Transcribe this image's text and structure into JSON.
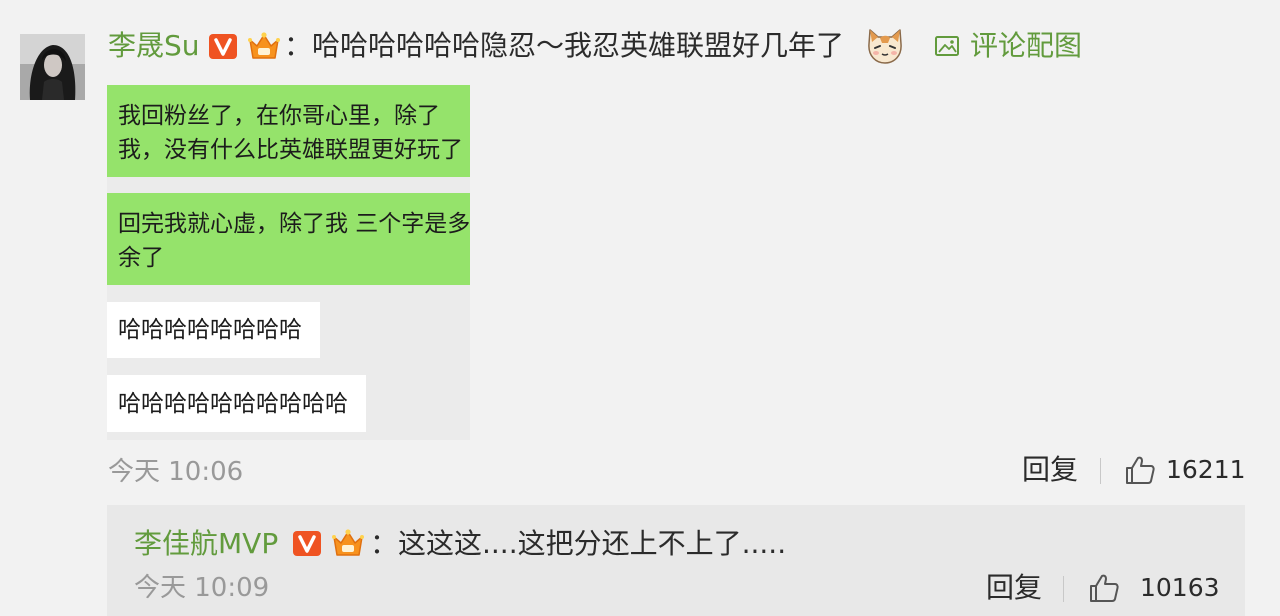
{
  "colors": {
    "page_background": "#f2f2f2",
    "link_green": "#629b3d",
    "text": "#2b2b2b",
    "muted_text": "#999999",
    "reply_box_background": "#e8e8e8",
    "image_background": "#ebebeb",
    "verified_badge": "#ef5322",
    "vip_badge": "#f7921e",
    "icon_gray": "#555555"
  },
  "comment": {
    "avatar_icon": "user-avatar",
    "username": "李晟Su",
    "badges": [
      "verified-v-icon",
      "vip-crown-icon"
    ],
    "text": "：哈哈哈哈哈哈隐忍～我忍英雄联盟好几年了",
    "emoji_icon": "cat-emoji-icon",
    "image_link": {
      "icon": "image-icon",
      "label": "评论配图"
    },
    "attached_image": {
      "messages": [
        {
          "bubble_color": "#95e36b",
          "lines": [
            "我回粉丝了，在你哥心里，除了",
            "我，没有什么比英雄联盟更好玩了"
          ]
        },
        {
          "bubble_color": "#95e36b",
          "lines": [
            "回完我就心虚，除了我 三个字是多",
            "余了"
          ]
        },
        {
          "bubble_color": "#ffffff",
          "lines": [
            "哈哈哈哈哈哈哈哈"
          ]
        },
        {
          "bubble_color": "#ffffff",
          "lines": [
            "哈哈哈哈哈哈哈哈哈哈"
          ]
        }
      ]
    },
    "time": "今天 10:06",
    "reply_label": "回复",
    "like_icon": "thumbs-up-icon",
    "like_count": "16211"
  },
  "reply": {
    "username": "李佳航MVP",
    "badges": [
      "verified-v-icon",
      "vip-crown-icon"
    ],
    "text": "：这这这....这把分还上不上了.....",
    "time": "今天 10:09",
    "reply_label": "回复",
    "like_icon": "thumbs-up-icon",
    "like_count": "10163"
  }
}
